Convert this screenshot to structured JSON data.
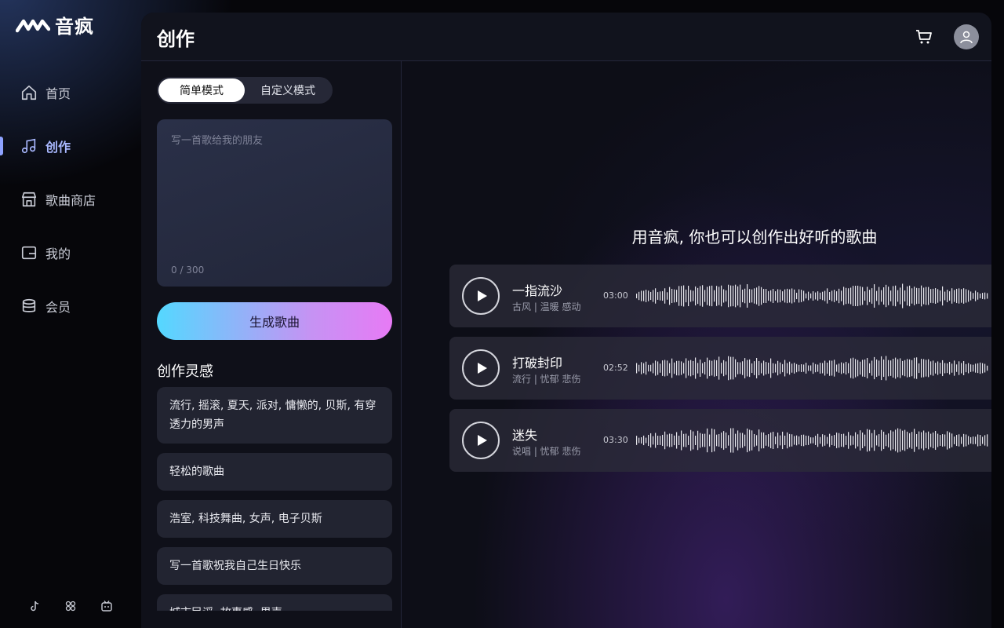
{
  "app": {
    "name": "音疯"
  },
  "sidebar": {
    "items": [
      {
        "label": "首页",
        "icon": "home-icon",
        "active": false
      },
      {
        "label": "创作",
        "icon": "music-note-icon",
        "active": true
      },
      {
        "label": "歌曲商店",
        "icon": "store-icon",
        "active": false
      },
      {
        "label": "我的",
        "icon": "wallet-icon",
        "active": false
      },
      {
        "label": "会员",
        "icon": "database-icon",
        "active": false
      }
    ],
    "social": [
      "tiktok-icon",
      "community-icon",
      "bilibili-icon"
    ]
  },
  "header": {
    "title": "创作"
  },
  "create": {
    "modes": {
      "simple": "简单模式",
      "custom": "自定义模式"
    },
    "prompt_placeholder": "写一首歌给我的朋友",
    "prompt_value": "",
    "counter": "0 / 300",
    "generate_label": "生成歌曲",
    "inspiration_title": "创作灵感",
    "inspirations": [
      "流行, 摇滚, 夏天, 派对, 慵懒的, 贝斯, 有穿透力的男声",
      "轻松的歌曲",
      "浩室, 科技舞曲, 女声, 电子贝斯",
      "写一首歌祝我自己生日快乐",
      "城市民谣, 故事感, 男声"
    ]
  },
  "showcase": {
    "headline": "用音疯, 你也可以创作出好听的歌曲",
    "songs": [
      {
        "title": "一指流沙",
        "tags": "古风 | 温暖 感动",
        "duration": "03:00"
      },
      {
        "title": "打破封印",
        "tags": "流行 | 忧郁 悲伤",
        "duration": "02:52"
      },
      {
        "title": "迷失",
        "tags": "说唱 | 忧郁 悲伤",
        "duration": "03:30"
      }
    ]
  },
  "colors": {
    "accent": "#8ea2ff",
    "gradient_start": "#54d8ff",
    "gradient_end": "#e77af5"
  }
}
